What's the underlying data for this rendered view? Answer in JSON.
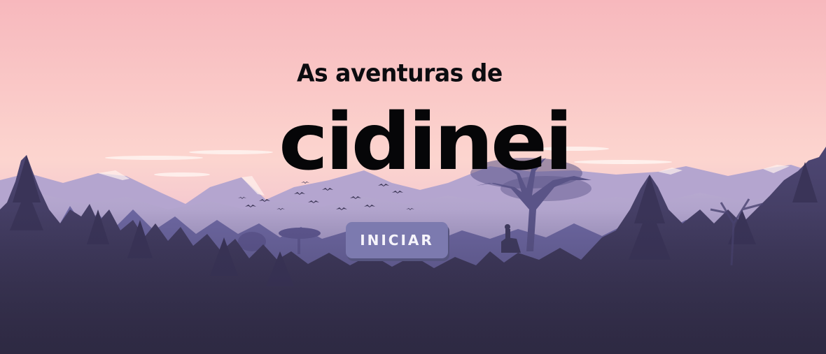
{
  "title_screen": {
    "subtitle": "As aventuras de",
    "title": "cidinei",
    "start_button_label": "INICIAR"
  },
  "colors": {
    "sky_top": "#f7b7bd",
    "sky_bottom": "#fbd7d0",
    "mountains_far": "#a39ac6",
    "mountains_mid": "#7f77ad",
    "forest_near": "#3b3555",
    "button": "#7c7aaf",
    "title_text": "#060608"
  }
}
